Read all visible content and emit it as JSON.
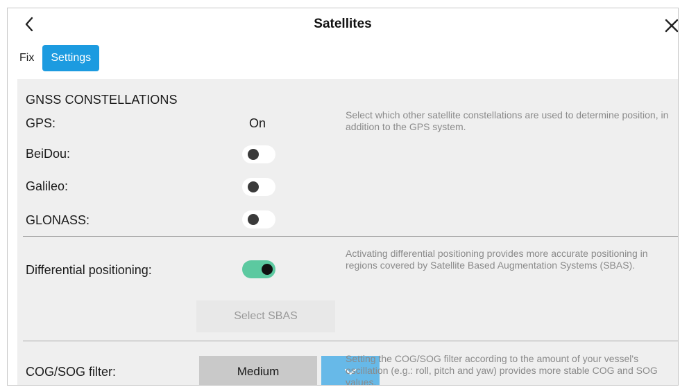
{
  "header": {
    "title": "Satellites"
  },
  "tabs": [
    {
      "label": "Fix",
      "active": false
    },
    {
      "label": "Settings",
      "active": true
    }
  ],
  "gnss": {
    "title": "GNSS CONSTELLATIONS",
    "description": "Select which other satellite constellations are used to determine position, in addition to the GPS system.",
    "gps": {
      "label": "GPS:",
      "value": "On"
    },
    "beidou": {
      "label": "BeiDou:",
      "enabled": false
    },
    "galileo": {
      "label": "Galileo:",
      "enabled": false
    },
    "glonass": {
      "label": "GLONASS:",
      "enabled": false
    }
  },
  "differential": {
    "label": "Differential positioning:",
    "enabled": true,
    "description": "Activating differential positioning provides more accurate positioning in regions covered by Satellite Based Augmentation Systems (SBAS).",
    "select_sbas_label": "Select SBAS"
  },
  "cog_sog": {
    "label": "COG/SOG filter:",
    "value": "Medium",
    "description": "Setting the COG/SOG filter according to the amount of your vessel's oscillation (e.g.: roll, pitch and yaw) provides more stable COG and SOG values."
  },
  "icons": {
    "back": "chevron-left-icon",
    "close": "close-icon",
    "dropdown": "chevron-down-icon"
  },
  "colors": {
    "accent": "#1c9be0",
    "toggle_on": "#5cc9a0",
    "panel_bg": "#efefef"
  }
}
